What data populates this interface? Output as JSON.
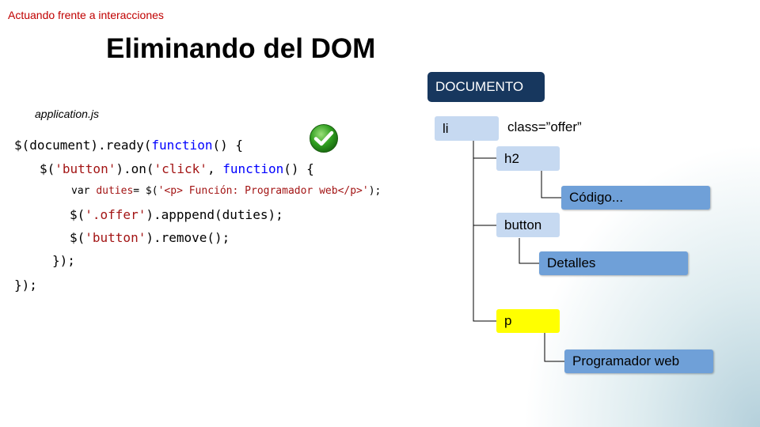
{
  "header": {
    "section": "Actuando frente a interacciones"
  },
  "slide": {
    "title": "Eliminando del DOM",
    "filename": "application.js"
  },
  "code": {
    "line1_a": "$(document).ready(",
    "line1_k": "function",
    "line1_b": "() {",
    "line2_a": "$(",
    "line2_s1": "'button'",
    "line2_b": ").on(",
    "line2_s2": "'click'",
    "line2_c": ", ",
    "line2_k": "function",
    "line2_d": "() {",
    "line3_a": "var ",
    "line3_s1": "duties",
    "line3_b": "= $(",
    "line3_s2": "'<p> Función: Programador web</p>'",
    "line3_c": ");",
    "line4_a": "$(",
    "line4_s": "'.offer'",
    "line4_b": ").apppend(duties);",
    "line5_a": "$(",
    "line5_s": "'button'",
    "line5_b": ").remove();",
    "line6": "});",
    "line7": "});"
  },
  "tree": {
    "root": "DOCUMENTO",
    "li": "li",
    "li_attr": "class=”offer”",
    "h2": "h2",
    "h2_text": "Código...",
    "button": "button",
    "button_text": "Detalles",
    "p": "p",
    "p_text": "Programador web"
  },
  "colors": {
    "root": "#17375e",
    "element": "#c6d9f1",
    "text_node": "#6fa0d8",
    "highlight": "#ffff00",
    "header": "#c00000"
  },
  "icons": {
    "status": "checkmark-icon"
  }
}
